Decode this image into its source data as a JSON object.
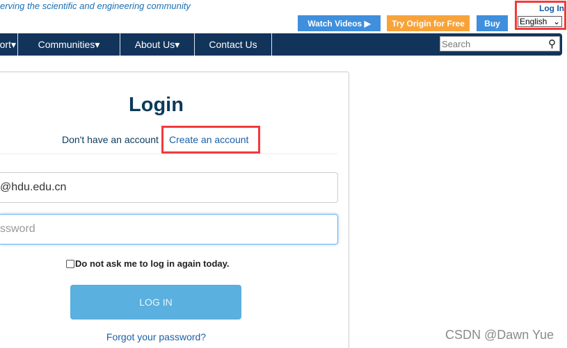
{
  "header": {
    "tagline": "erving the scientific and engineering community",
    "watch_videos": "Watch Videos",
    "try_origin": "Try Origin for Free",
    "buy": "Buy",
    "log_in": "Log In",
    "language": "English"
  },
  "nav": {
    "items": [
      "ort",
      "Communities",
      "About Us",
      "Contact Us"
    ],
    "search_placeholder": "Search"
  },
  "login": {
    "title": "Login",
    "no_account": "Don't have an account",
    "create_account": "Create an account",
    "email_value": "@hdu.edu.cn",
    "password_placeholder": "ssword",
    "remember": "Do not ask me to log in again today.",
    "login_button": "LOG IN",
    "forgot": "Forgot your password?"
  },
  "watermark": "CSDN @Dawn Yue",
  "colors": {
    "nav": "#12345a",
    "accent": "#3f8fdc",
    "orange": "#f7a33a",
    "highlight": "#f23a3a",
    "login_button": "#5ab0df"
  }
}
